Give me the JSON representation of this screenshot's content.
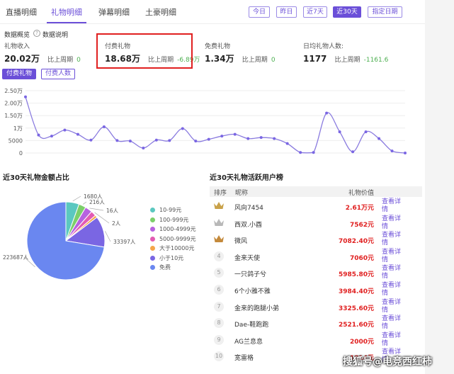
{
  "tabs": [
    {
      "label": "直播明细"
    },
    {
      "label": "礼物明细"
    },
    {
      "label": "弹幕明细"
    },
    {
      "label": "土豪明细"
    }
  ],
  "date_filters": [
    "今日",
    "昨日",
    "近7天",
    "近30天",
    "指定日期"
  ],
  "overview": {
    "title": "数据概览",
    "help": "数据说明",
    "metrics": [
      {
        "label": "礼物收入",
        "value": "20.02万",
        "cmp_label": "比上周期",
        "cmp_value": "0"
      },
      {
        "label": "付费礼物",
        "value": "18.68万",
        "cmp_label": "比上周期",
        "cmp_value": "-6.89万"
      },
      {
        "label": "免费礼物",
        "value": "1.34万",
        "cmp_label": "比上周期",
        "cmp_value": "0"
      },
      {
        "label": "日均礼物人数:",
        "value": "1177",
        "cmp_label": "比上周期",
        "cmp_value": "-1161.6"
      }
    ]
  },
  "chart_tabs": [
    "付费礼物",
    "付费人数"
  ],
  "chart_data": [
    {
      "type": "line",
      "y_ticks": [
        "2.50万",
        "2.00万",
        "1.50万",
        "1万",
        "5000",
        "0"
      ],
      "ylim": [
        0,
        25000
      ],
      "x": [
        1,
        2,
        3,
        4,
        5,
        6,
        7,
        8,
        9,
        10,
        11,
        12,
        13,
        14,
        15,
        16,
        17,
        18,
        19,
        20,
        21,
        22,
        23,
        24,
        25,
        26,
        27,
        28,
        29,
        30
      ],
      "series": [
        {
          "values": [
            22500,
            7200,
            6800,
            9200,
            7500,
            5200,
            10500,
            5000,
            4800,
            2000,
            5200,
            5000,
            9800,
            4800,
            5500,
            6800,
            7500,
            5800,
            6200,
            5800,
            3800,
            200,
            200,
            16000,
            8500,
            500,
            8500,
            5800,
            800,
            0
          ]
        }
      ]
    },
    {
      "type": "pie",
      "slices": [
        {
          "name": "10-99元",
          "value": 1680,
          "label": "1680人",
          "color": "#5bc8c0"
        },
        {
          "name": "100-999元",
          "value": 216,
          "label": "216人",
          "color": "#7ccf6a"
        },
        {
          "name": "1000-4999元",
          "value": 16,
          "label": "16人",
          "color": "#b761e0"
        },
        {
          "name": "5000-9999元",
          "value": 2,
          "label": "2人",
          "color": "#e25bb3"
        },
        {
          "name": "大于10000元",
          "value": 1,
          "label": "",
          "color": "#f4a64a"
        },
        {
          "name": "小于10元",
          "value": 33397,
          "label": "33397人",
          "color": "#7a66e3"
        },
        {
          "name": "免费",
          "value": 223687,
          "label": "223687人",
          "color": "#6a87f0"
        }
      ]
    }
  ],
  "pie_section_title": "近30天礼物金额占比",
  "rank": {
    "title": "近30天礼物活跃用户榜",
    "headers": {
      "rank": "排序",
      "name": "昵称",
      "value": "礼物价值"
    },
    "link_text": "查看详情",
    "rows": [
      {
        "rank": "1",
        "name": "风向7454",
        "value": "2.61万元"
      },
      {
        "rank": "2",
        "name": "西双.小酉",
        "value": "7562元"
      },
      {
        "rank": "3",
        "name": "微风",
        "value": "7082.40元"
      },
      {
        "rank": "4",
        "name": "金来天使",
        "value": "7060元"
      },
      {
        "rank": "5",
        "name": "一只鸽子兮",
        "value": "5985.80元"
      },
      {
        "rank": "6",
        "name": "6个小雅不雅",
        "value": "3984.40元"
      },
      {
        "rank": "7",
        "name": "金来的跑腿小弟",
        "value": "3325.60元"
      },
      {
        "rank": "8",
        "name": "Dae-鞋跑跑",
        "value": "2521.60元"
      },
      {
        "rank": "9",
        "name": "AG兰息息",
        "value": "2000元"
      },
      {
        "rank": "10",
        "name": "宽雷格",
        "value": "1814元"
      }
    ]
  },
  "watermark": "搜狐号@电竞西红柿",
  "colors": {
    "accent": "#6b4fd8",
    "highlight_box": "#e02020",
    "value_red": "#e02020",
    "positive": "#4caf50"
  }
}
